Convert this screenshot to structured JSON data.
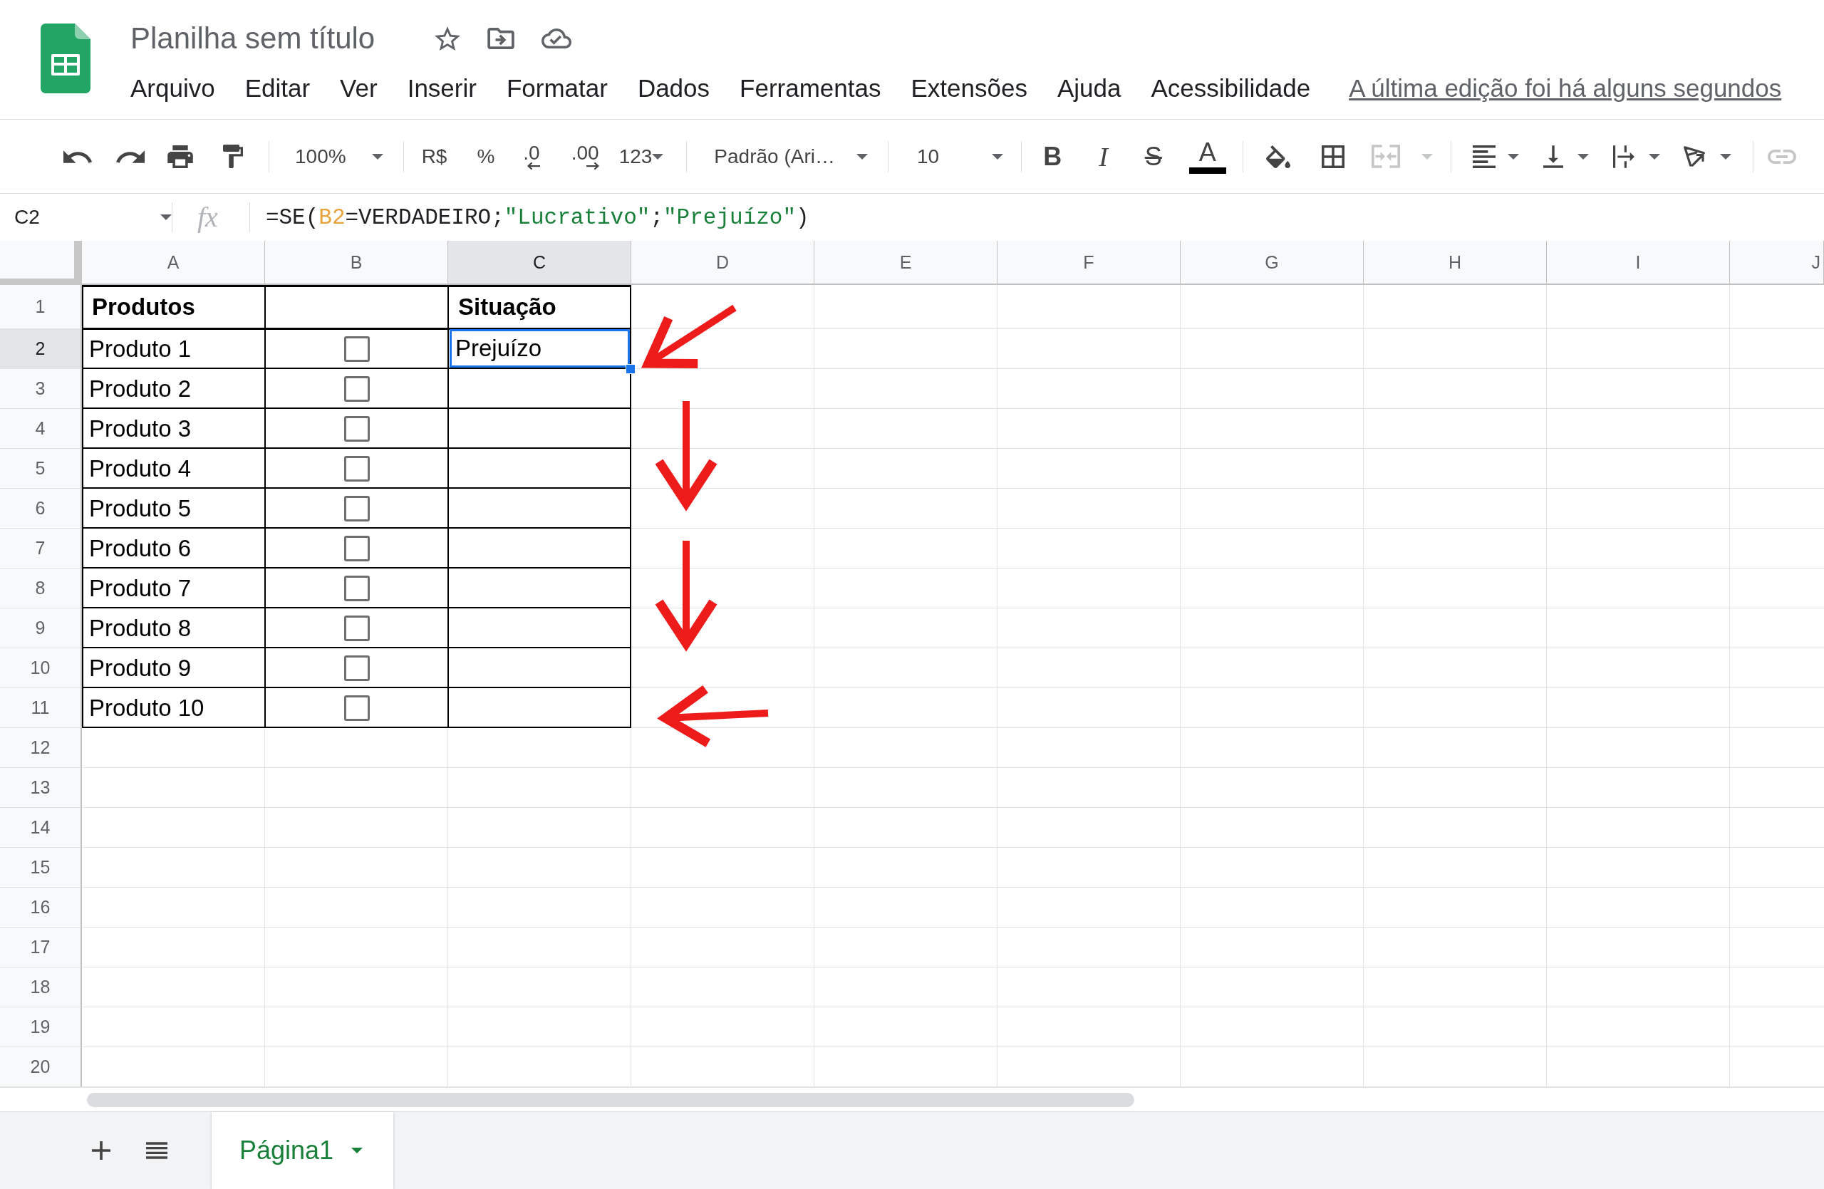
{
  "app": {
    "title": "Planilha sem título",
    "last_edit": "A última edição foi há alguns segundos"
  },
  "menu": [
    "Arquivo",
    "Editar",
    "Ver",
    "Inserir",
    "Formatar",
    "Dados",
    "Ferramentas",
    "Extensões",
    "Ajuda",
    "Acessibilidade"
  ],
  "toolbar": {
    "zoom": "100%",
    "currency": "R$",
    "percent": "%",
    "decrease_decimals": ".0",
    "increase_decimals": ".00",
    "number_format": "123",
    "font": "Padrão (Ari…",
    "font_size": "10",
    "bold": "B",
    "italic": "I",
    "strikethrough": "S",
    "text_color": "A",
    "merge_cells": {
      "disabled": true
    },
    "insert_link": {
      "disabled": true
    }
  },
  "formula_bar": {
    "cell": "C2",
    "fx": "fx",
    "formula": [
      {
        "kind": "plain",
        "text": "=SE("
      },
      {
        "kind": "reference",
        "text": "B2"
      },
      {
        "kind": "plain",
        "text": "=VERDADEIRO;"
      },
      {
        "kind": "string",
        "text": "\"Lucrativo\""
      },
      {
        "kind": "plain",
        "text": ";"
      },
      {
        "kind": "string",
        "text": "\"Prejuízo\""
      },
      {
        "kind": "plain",
        "text": ")"
      }
    ]
  },
  "sheet": {
    "columns": [
      {
        "label": "A",
        "selected": false
      },
      {
        "label": "B",
        "selected": false
      },
      {
        "label": "C",
        "selected": true
      },
      {
        "label": "D",
        "selected": false
      },
      {
        "label": "E",
        "selected": false
      },
      {
        "label": "F",
        "selected": false
      },
      {
        "label": "G",
        "selected": false
      },
      {
        "label": "H",
        "selected": false
      },
      {
        "label": "I",
        "selected": false
      },
      {
        "label": "J",
        "selected": false
      }
    ],
    "row_numbers": [
      {
        "label": "1",
        "selected": false
      },
      {
        "label": "2",
        "selected": true
      },
      {
        "label": "3",
        "selected": false
      },
      {
        "label": "4",
        "selected": false
      },
      {
        "label": "5",
        "selected": false
      },
      {
        "label": "6",
        "selected": false
      },
      {
        "label": "7",
        "selected": false
      },
      {
        "label": "8",
        "selected": false
      },
      {
        "label": "9",
        "selected": false
      },
      {
        "label": "10",
        "selected": false
      },
      {
        "label": "11",
        "selected": false
      },
      {
        "label": "12",
        "selected": false
      },
      {
        "label": "13",
        "selected": false
      },
      {
        "label": "14",
        "selected": false
      },
      {
        "label": "15",
        "selected": false
      },
      {
        "label": "16",
        "selected": false
      },
      {
        "label": "17",
        "selected": false
      },
      {
        "label": "18",
        "selected": false
      },
      {
        "label": "19",
        "selected": false
      },
      {
        "label": "20",
        "selected": false
      }
    ],
    "header": {
      "product": "Produtos",
      "status": "Situação"
    },
    "rows": [
      {
        "product": "Produto 1",
        "checked": false,
        "status": "Prejuízo",
        "selected": true
      },
      {
        "product": "Produto 2",
        "checked": false,
        "selected": false
      },
      {
        "product": "Produto 3",
        "checked": false,
        "selected": false
      },
      {
        "product": "Produto 4",
        "checked": false,
        "selected": false
      },
      {
        "product": "Produto 5",
        "checked": false,
        "selected": false
      },
      {
        "product": "Produto 6",
        "checked": false,
        "selected": false
      },
      {
        "product": "Produto 7",
        "checked": false,
        "selected": false
      },
      {
        "product": "Produto 8",
        "checked": false,
        "selected": false
      },
      {
        "product": "Produto 9",
        "checked": false,
        "selected": false
      },
      {
        "product": "Produto 10",
        "checked": false,
        "selected": false
      }
    ]
  },
  "sheet_tabs": [
    {
      "label": "Página1",
      "selected": true
    }
  ]
}
